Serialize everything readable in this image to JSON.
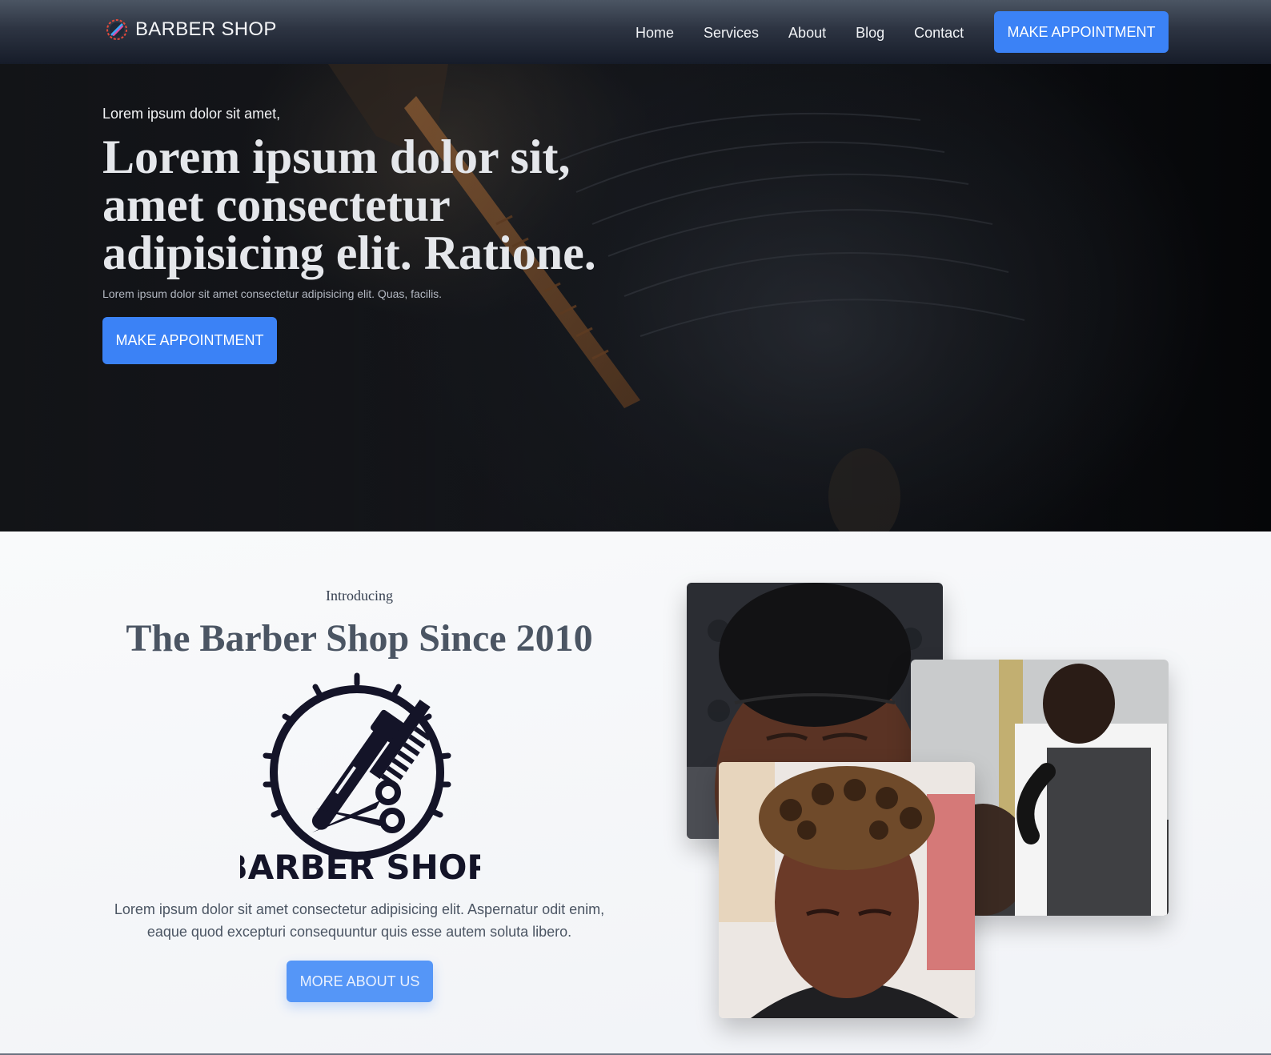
{
  "header": {
    "brand": "BARBER SHOP",
    "nav": [
      "Home",
      "Services",
      "About",
      "Blog",
      "Contact"
    ],
    "cta": "MAKE APPOINTMENT"
  },
  "hero": {
    "pretitle": "Lorem ipsum dolor sit amet,",
    "title": "Lorem ipsum dolor sit, amet consectetur adipisicing elit. Ratione.",
    "subtitle": "Lorem ipsum dolor sit amet consectetur adipisicing elit. Quas, facilis.",
    "cta": "MAKE APPOINTMENT"
  },
  "about": {
    "intro": "Introducing",
    "title": "The Barber Shop Since 2010",
    "logo_text": "BARBER SHOP",
    "text": "Lorem ipsum dolor sit amet consectetur adipisicing elit. Aspernatur odit enim, eaque quod excepturi consequuntur quis esse autem soluta libero.",
    "cta": "MORE ABOUT US"
  },
  "colors": {
    "accent": "#3b82f6",
    "logo_dark": "#141428"
  },
  "icons": [
    "barber-pole-logo-icon",
    "barber-emblem-icon"
  ]
}
